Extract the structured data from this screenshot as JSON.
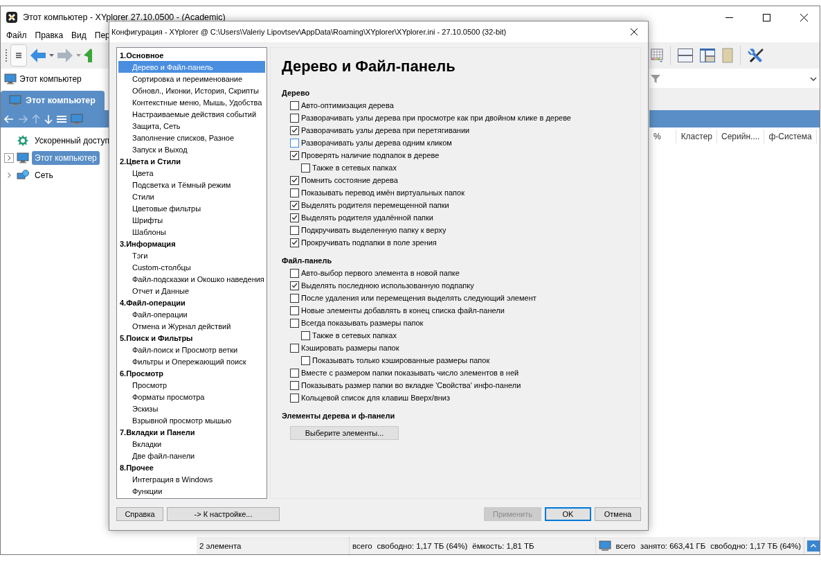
{
  "main_window": {
    "title": "Этот компьютер - XYplorer 27.10.0500 - (Academic)",
    "menu": [
      "Файл",
      "Правка",
      "Вид",
      "Пер"
    ],
    "address": "Этот компьютер",
    "tab": {
      "label": "Этот компьютер",
      "selected": true
    },
    "tree": [
      {
        "label": "Ускоренный доступ",
        "kind": "quick-access",
        "selected": false,
        "expandable": false
      },
      {
        "label": "Этот компьютер",
        "kind": "computer",
        "selected": true,
        "expandable": true
      },
      {
        "label": "Сеть",
        "kind": "network",
        "selected": false,
        "expandable": true
      }
    ],
    "columns": [
      "%",
      "Кластер",
      "Серийн....",
      "ф-Система"
    ],
    "status_bar": [
      {
        "kind": "text",
        "texts": [
          "2 элемента"
        ]
      },
      {
        "kind": "text",
        "texts": [
          "всего",
          "свободно: 1,17 ТБ (64%)",
          "ёмкость: 1,81 ТБ"
        ]
      },
      {
        "kind": "drive",
        "texts": [
          "всего",
          "занято: 663,41 ГБ",
          "свободно: 1,17 ТБ (64%)"
        ]
      }
    ]
  },
  "dialog": {
    "title": "Конфигурация - XYplorer @ C:\\Users\\Valeriy Lipovtsev\\AppData\\Roaming\\XYplorer\\XYplorer.ini - 27.10.0500 (32-bit)",
    "nav": [
      {
        "label": "1.Основное",
        "children": [
          {
            "label": "Дерево и Файл-панель",
            "selected": true
          },
          {
            "label": "Сортировка и переименование",
            "selected": false
          },
          {
            "label": "Обновл., Иконки, История, Скрипты",
            "selected": false
          },
          {
            "label": "Контекстные меню, Мышь, Удобства",
            "selected": false
          },
          {
            "label": "Настраиваемые действия событий",
            "selected": false
          },
          {
            "label": "Защита, Сеть",
            "selected": false
          },
          {
            "label": "Заполнение списков, Разное",
            "selected": false
          },
          {
            "label": "Запуск и Выход",
            "selected": false
          }
        ]
      },
      {
        "label": "2.Цвета и Стили",
        "children": [
          {
            "label": "Цвета",
            "selected": false
          },
          {
            "label": "Подсветка и Тёмный режим",
            "selected": false
          },
          {
            "label": "Стили",
            "selected": false
          },
          {
            "label": "Цветовые фильтры",
            "selected": false
          },
          {
            "label": "Шрифты",
            "selected": false
          },
          {
            "label": "Шаблоны",
            "selected": false
          }
        ]
      },
      {
        "label": "3.Информация",
        "children": [
          {
            "label": "Тэги",
            "selected": false
          },
          {
            "label": "Custom-столбцы",
            "selected": false
          },
          {
            "label": "Файл-подсказки и Окошко наведения",
            "selected": false
          },
          {
            "label": "Отчет и Данные",
            "selected": false
          }
        ]
      },
      {
        "label": "4.Файл-операции",
        "children": [
          {
            "label": "Файл-операции",
            "selected": false
          },
          {
            "label": "Отмена и Журнал действий",
            "selected": false
          }
        ]
      },
      {
        "label": "5.Поиск и Фильтры",
        "children": [
          {
            "label": "Файл-поиск и Просмотр ветки",
            "selected": false
          },
          {
            "label": "Фильтры и Опережающий поиск",
            "selected": false
          }
        ]
      },
      {
        "label": "6.Просмотр",
        "children": [
          {
            "label": "Просмотр",
            "selected": false
          },
          {
            "label": "Форматы просмотра",
            "selected": false
          },
          {
            "label": "Эскизы",
            "selected": false
          },
          {
            "label": "Взрывной просмотр мышью",
            "selected": false
          }
        ]
      },
      {
        "label": "7.Вкладки и Панели",
        "children": [
          {
            "label": "Вкладки",
            "selected": false
          },
          {
            "label": "Две файл-панели",
            "selected": false
          }
        ]
      },
      {
        "label": "8.Прочее",
        "children": [
          {
            "label": "Интеграция в Windows",
            "selected": false
          },
          {
            "label": "Функции",
            "selected": false
          }
        ]
      }
    ],
    "heading": "Дерево и Файл-панель",
    "sections": [
      {
        "title": "Дерево",
        "options": [
          {
            "label": "Авто-оптимизация дерева",
            "checked": false,
            "hot": false
          },
          {
            "label": "Разворачивать узлы дерева при просмотре как при двойном клике в дереве",
            "checked": false,
            "hot": false
          },
          {
            "label": "Разворачивать узлы дерева при перетягивании",
            "checked": true,
            "hot": false
          },
          {
            "label": "Разворачивать узлы дерева одним кликом",
            "checked": false,
            "hot": true
          },
          {
            "label": "Проверять наличие подпапок в дереве",
            "checked": true,
            "hot": false,
            "children": [
              {
                "label": "Также в сетевых папках",
                "checked": false,
                "hot": false
              }
            ]
          },
          {
            "label": "Помнить состояние дерева",
            "checked": true,
            "hot": false
          },
          {
            "label": "Показывать перевод имён виртуальных папок",
            "checked": false,
            "hot": false
          },
          {
            "label": "Выделять родителя перемещенной папки",
            "checked": true,
            "hot": false
          },
          {
            "label": "Выделять родителя удалённой папки",
            "checked": true,
            "hot": false
          },
          {
            "label": "Подкручивать выделенную папку к верху",
            "checked": false,
            "hot": false
          },
          {
            "label": "Прокручивать подпапки в поле зрения",
            "checked": true,
            "hot": false
          }
        ]
      },
      {
        "title": "Файл-панель",
        "options": [
          {
            "label": "Авто-выбор первого элемента в новой папке",
            "checked": false,
            "hot": false
          },
          {
            "label": "Выделять последнюю использованную подпапку",
            "checked": true,
            "hot": false
          },
          {
            "label": "После удаления или перемещения выделять следующий элемент",
            "checked": false,
            "hot": false
          },
          {
            "label": "Новые элементы добавлять в конец списка файл-панели",
            "checked": false,
            "hot": false
          },
          {
            "label": "Всегда показывать размеры папок",
            "checked": false,
            "hot": false,
            "children": [
              {
                "label": "Также в сетевых папках",
                "checked": false,
                "hot": false
              }
            ]
          },
          {
            "label": "Кэшировать размеры папок",
            "checked": false,
            "hot": false,
            "children": [
              {
                "label": "Показывать только кэшированные размеры папок",
                "checked": false,
                "hot": false
              }
            ]
          },
          {
            "label": "Вместе с размером папки показывать число элементов в ней",
            "checked": false,
            "hot": false
          },
          {
            "label": "Показывать размер папки во вкладке 'Свойства' инфо-панели",
            "checked": false,
            "hot": false
          },
          {
            "label": "Кольцевой список для клавиш Вверх/вниз",
            "checked": false,
            "hot": false
          }
        ]
      },
      {
        "title": "Элементы дерева и ф-панели",
        "button": "Выберите элементы..."
      }
    ],
    "left_buttons": [
      {
        "label": "Справка",
        "disabled": false,
        "default": false
      },
      {
        "label": "-> К настройке...",
        "disabled": false,
        "default": false
      }
    ],
    "right_buttons": [
      {
        "label": "Применить",
        "disabled": true,
        "default": false
      },
      {
        "label": "OK",
        "disabled": false,
        "default": true
      },
      {
        "label": "Отмена",
        "disabled": false,
        "default": false
      }
    ]
  }
}
